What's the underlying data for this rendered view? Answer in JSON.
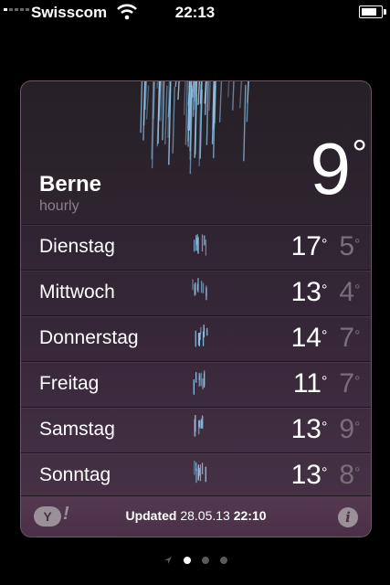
{
  "status_bar": {
    "carrier": "Swisscom",
    "time": "22:13",
    "signal_bars": 5,
    "signal_bars_filled": 1,
    "battery_level": 0.9
  },
  "weather": {
    "city": "Berne",
    "subtitle": "hourly",
    "current_temp": "9",
    "degree_symbol": "°",
    "forecast": [
      {
        "day": "Dienstag",
        "high": "17",
        "low": "5",
        "icon": "rain-icon"
      },
      {
        "day": "Mittwoch",
        "high": "13",
        "low": "4",
        "icon": "rain-icon"
      },
      {
        "day": "Donnerstag",
        "high": "14",
        "low": "7",
        "icon": "rain-icon"
      },
      {
        "day": "Freitag",
        "high": "11",
        "low": "7",
        "icon": "rain-icon"
      },
      {
        "day": "Samstag",
        "high": "13",
        "low": "9",
        "icon": "rain-icon"
      },
      {
        "day": "Sonntag",
        "high": "13",
        "low": "8",
        "icon": "rain-icon"
      }
    ]
  },
  "footer": {
    "yahoo_logo": "Y",
    "yahoo_bang": "!",
    "updated_label": "Updated",
    "updated_date": "28.05.13",
    "updated_time": "22:10",
    "info_icon": "i"
  },
  "pager": {
    "pages": 3,
    "active_page": 1
  },
  "colors": {
    "background": "#000000",
    "card_top": "#262026",
    "card_bottom": "#4a3448",
    "low_temp": "#7a6e79",
    "rain": "#8fc4ea"
  }
}
